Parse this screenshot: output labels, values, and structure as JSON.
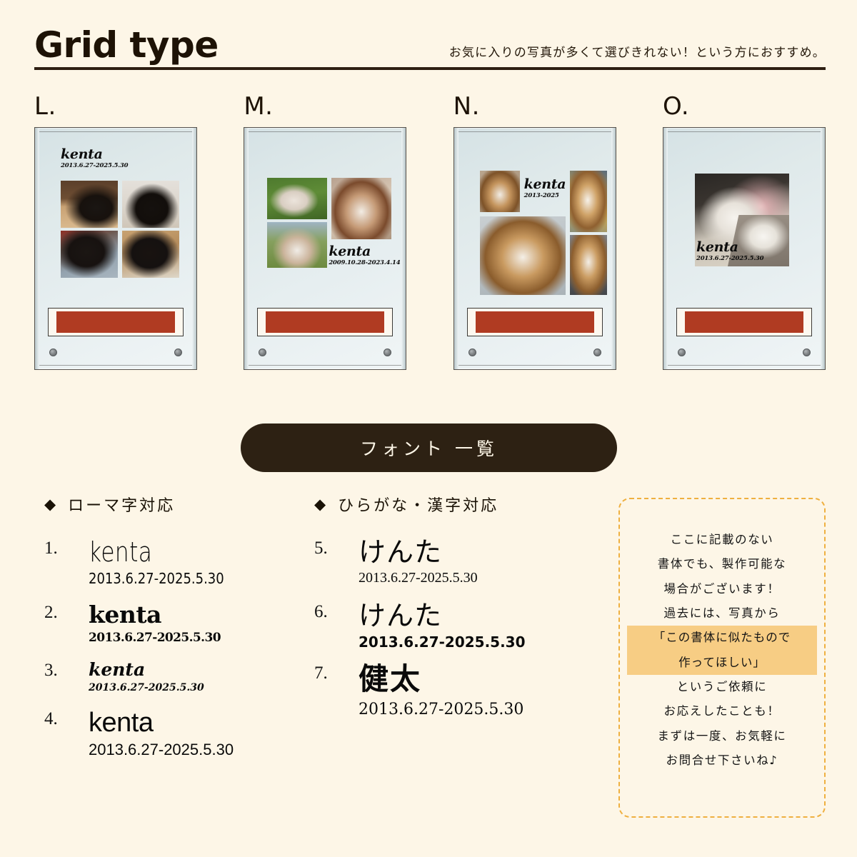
{
  "header": {
    "title": "Grid type",
    "tagline": "お気に入りの写真が多くて選びきれない！という方におすすめ。"
  },
  "panels": [
    {
      "letter": "L.",
      "name": "kenta",
      "date": "2013.6.27-2025.5.30",
      "layout": "2x2-grid-cats",
      "caption_position": "top-left"
    },
    {
      "letter": "M.",
      "name": "kenta",
      "date": "2009.10.28-2023.4.14",
      "layout": "3-photo-dogs",
      "caption_position": "bottom-right"
    },
    {
      "letter": "N.",
      "name": "kenta",
      "date": "2013-2025",
      "layout": "4-photo-sheltie",
      "caption_position": "top-center"
    },
    {
      "letter": "O.",
      "name": "kenta",
      "date": "2013.6.27-2025.5.30",
      "layout": "diagonal-split-cats",
      "caption_position": "bottom-left"
    }
  ],
  "font_list_button": {
    "label": "フォント 一覧"
  },
  "romaji": {
    "diamond": "◆",
    "heading": "ローマ字対応",
    "items": [
      {
        "num": "1.",
        "name": "kenta",
        "date": "2013.6.27-2025.5.30"
      },
      {
        "num": "2.",
        "name": "kenta",
        "date": "2013.6.27-2025.5.30"
      },
      {
        "num": "3.",
        "name": "kenta",
        "date": "2013.6.27-2025.5.30"
      },
      {
        "num": "4.",
        "name": "kenta",
        "date": "2013.6.27-2025.5.30"
      }
    ]
  },
  "kanji": {
    "diamond": "◆",
    "heading": "ひらがな・漢字対応",
    "items": [
      {
        "num": "5.",
        "name": "けんた",
        "date": "2013.6.27-2025.5.30"
      },
      {
        "num": "6.",
        "name": "けんた",
        "date": "2013.6.27-2025.5.30"
      },
      {
        "num": "7.",
        "name": "健太",
        "date": "2013.6.27-2025.5.30"
      }
    ]
  },
  "note": {
    "lines": [
      "ここに記載のない",
      "書体でも、製作可能な",
      "場合がございます！",
      "過去には、写真から"
    ],
    "highlight": [
      "「この書体に似たもので",
      "作ってほしい」"
    ],
    "lines_after": [
      "というご依頼に",
      "お応えしたことも！",
      "まずは一度、お気軽に",
      "お問合せ下さいね♪"
    ]
  },
  "colors": {
    "background": "#fdf6e7",
    "ink": "#1d1205",
    "pill": "#2d2113",
    "base_bar": "#b03b22",
    "note_border": "#efb040",
    "note_highlight": "#f7cd84"
  }
}
